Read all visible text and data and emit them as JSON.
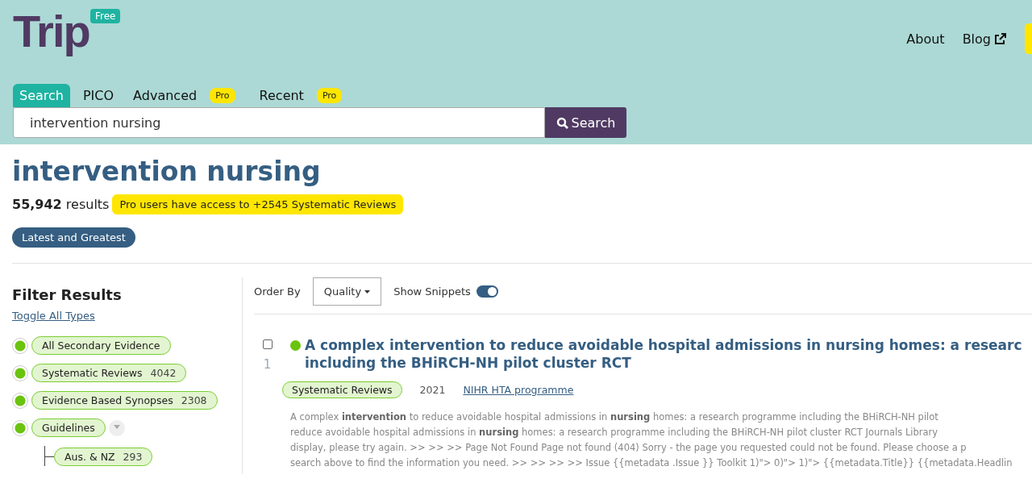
{
  "header": {
    "logo": "Trip",
    "plan_badge": "Free",
    "nav": [
      {
        "label": "About",
        "external": false
      },
      {
        "label": "Blog",
        "external": true
      }
    ]
  },
  "search_tabs": [
    {
      "label": "Search",
      "selected": true
    },
    {
      "label": "PICO",
      "selected": false
    },
    {
      "label": "Advanced",
      "selected": false,
      "badge": "Pro"
    },
    {
      "label": "Recent",
      "selected": false,
      "badge": "Pro"
    }
  ],
  "search": {
    "value": "intervention nursing",
    "button": "Search"
  },
  "query_title": "intervention nursing",
  "results_count": {
    "number": "55,942",
    "label": "results"
  },
  "pro_notice": "Pro users have access to +2545 Systematic Reviews",
  "latest_button": "Latest and Greatest",
  "filters": {
    "title": "Filter Results",
    "toggle_link": "Toggle All Types",
    "items": [
      {
        "label": "All Secondary Evidence",
        "selected": true
      },
      {
        "label": "Systematic Reviews",
        "count": "4042",
        "selected": true
      },
      {
        "label": "Evidence Based Synopses",
        "count": "2308",
        "selected": true
      },
      {
        "label": "Guidelines",
        "selected": true,
        "expanded": true,
        "children": [
          {
            "label": "Aus. & NZ",
            "count": "293"
          }
        ]
      }
    ]
  },
  "toolbar": {
    "order_label": "Order By",
    "order_value": "Quality",
    "snippets_label": "Show Snippets",
    "snippets_on": true
  },
  "results": [
    {
      "number": "1",
      "checked": false,
      "title_lines": [
        "A complex intervention to reduce avoidable hospital admissions in nursing homes: a researc",
        "including the BHiRCH-NH pilot cluster RCT"
      ],
      "type": "Systematic Reviews",
      "year": "2021",
      "source": "NIHR HTA programme",
      "snippet_lines": [
        "A complex  **intervention**  to reduce avoidable hospital admissions in  **nursing**  homes: a research programme including the BHiRCH-NH pilot",
        "reduce avoidable hospital admissions in  **nursing**  homes: a research programme including the BHiRCH-NH pilot cluster RCT Journals Library",
        "display, please try again. >> >> >> Page Not Found Page not found (404) Sorry - the page you requested could not be found. Please choose a p",
        "search above to find the information you need. >> >> >> >> Issue {{metadata .Issue }} Toolkit 1)\"> 0)\"> 1)\"> {{metadata.Title}} {{metadata.Headlin"
      ]
    }
  ]
}
